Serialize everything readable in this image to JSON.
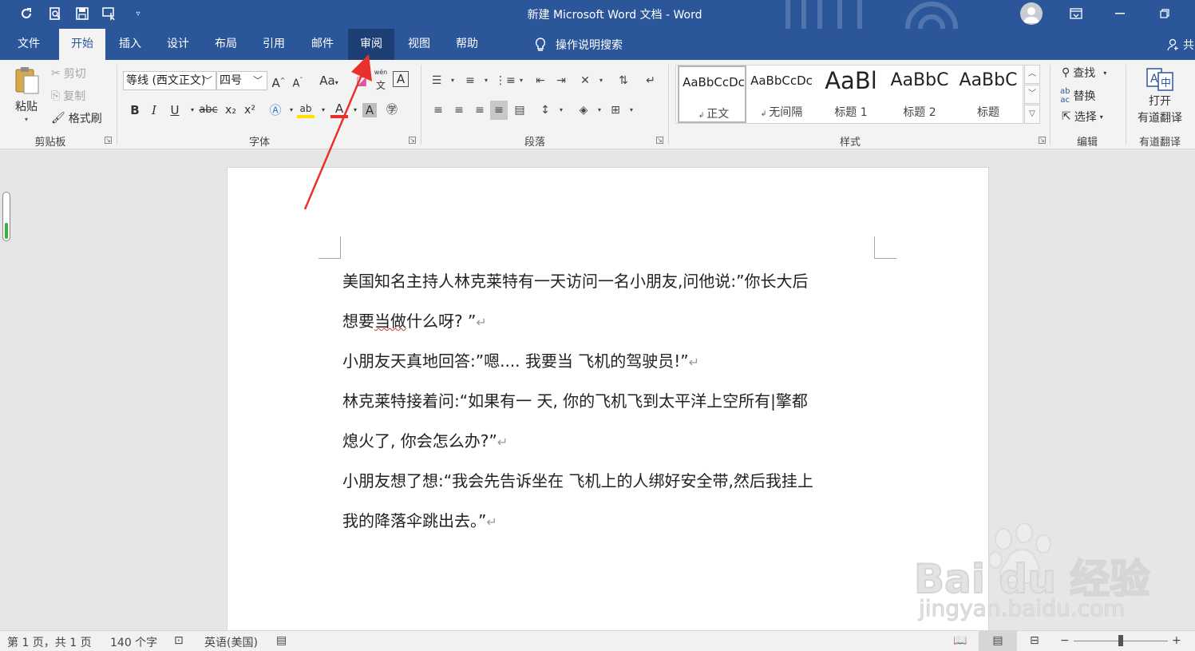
{
  "titlebar": {
    "title": "新建 Microsoft Word 文档  -  Word",
    "quick_access": [
      "autosave-icon",
      "print-preview-icon",
      "save-icon",
      "touch-mode-icon",
      "customize-qat-icon"
    ],
    "bg": "#2b579a"
  },
  "tabs": [
    "文件",
    "开始",
    "插入",
    "设计",
    "布局",
    "引用",
    "邮件",
    "审阅",
    "视图",
    "帮助"
  ],
  "tell_me": "操作说明搜索",
  "share": "共",
  "clipboard": {
    "paste": "粘贴",
    "cut": "剪切",
    "copy": "复制",
    "format_painter": "格式刷",
    "label": "剪贴板"
  },
  "font": {
    "name": "等线 (西文正文)",
    "size": "四号",
    "change_case": "Aa",
    "bold": "B",
    "italic": "I",
    "underline": "U",
    "strike": "abc",
    "subscript": "x₂",
    "superscript": "x²",
    "label": "字体"
  },
  "paragraph": {
    "label": "段落"
  },
  "styles": {
    "items": [
      {
        "sample": "AaBbCcDc",
        "name": "正文"
      },
      {
        "sample": "AaBbCcDc",
        "name": "无间隔"
      },
      {
        "sample": "AaBl",
        "name": "标题 1"
      },
      {
        "sample": "AaBbC",
        "name": "标题 2"
      },
      {
        "sample": "AaBbC",
        "name": "标题"
      }
    ],
    "label": "样式"
  },
  "editing": {
    "find": "查找",
    "replace": "替换",
    "select": "选择",
    "label": "编辑"
  },
  "youdao": {
    "open_line1": "打开",
    "open_line2": "有道翻译",
    "label": "有道翻译"
  },
  "document": {
    "lines": [
      "美国知名主持人林克莱特有一天访问一名小朋友,问他说:”你长大后",
      "想要",
      "当做",
      "什么呀? ”",
      "小朋友天真地回答:”嗯....  我要当  飞机的驾驶员!”",
      "林克莱特接着问:“如果有一  天,  你的飞机飞到太平洋上空所有|擎都",
      "熄火了,  你会怎么办?”",
      "小朋友想了想:“我会先告诉坐在  飞机上的人绑好安全带,然后我挂上",
      "我的降落伞跳出去。”"
    ],
    "para_mark": "↵"
  },
  "status": {
    "page": "第 1 页，共 1 页",
    "words": "140 个字",
    "language": "英语(美国)"
  },
  "watermark": {
    "brand": "Bai du 经验",
    "url": "jingyan.baidu.com"
  },
  "colors": {
    "accent": "#2b579a",
    "arrow": "#e8312a"
  }
}
